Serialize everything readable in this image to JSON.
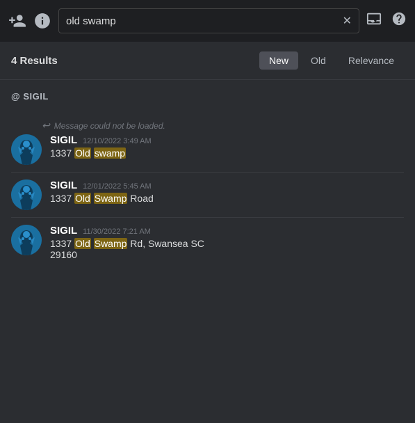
{
  "toolbar": {
    "search_value": "old swamp",
    "search_placeholder": "Search",
    "clear_button_label": "✕"
  },
  "results": {
    "count_label": "4 Results",
    "filters": [
      {
        "id": "new",
        "label": "New",
        "active": true
      },
      {
        "id": "old",
        "label": "Old",
        "active": false
      },
      {
        "id": "relevance",
        "label": "Relevance",
        "active": false
      }
    ]
  },
  "channel": {
    "label": "@ SIGIL"
  },
  "messages": [
    {
      "id": "msg1",
      "has_reply": true,
      "reply_text": "Message could not be loaded.",
      "author": "SIGIL",
      "timestamp": "12/10/2022 3:49 AM",
      "text_parts": [
        {
          "type": "plain",
          "text": "1337 "
        },
        {
          "type": "highlight",
          "text": "Old"
        },
        {
          "type": "plain",
          "text": " "
        },
        {
          "type": "highlight",
          "text": "swamp"
        }
      ]
    },
    {
      "id": "msg2",
      "has_reply": false,
      "author": "SIGIL",
      "timestamp": "12/01/2022 5:45 AM",
      "text_parts": [
        {
          "type": "plain",
          "text": "1337 "
        },
        {
          "type": "highlight",
          "text": "Old"
        },
        {
          "type": "plain",
          "text": " "
        },
        {
          "type": "highlight",
          "text": "Swamp"
        },
        {
          "type": "plain",
          "text": " Road"
        }
      ]
    },
    {
      "id": "msg3",
      "has_reply": false,
      "author": "SIGIL",
      "timestamp": "11/30/2022 7:21 AM",
      "text_parts": [
        {
          "type": "plain",
          "text": "1337 "
        },
        {
          "type": "highlight",
          "text": "Old"
        },
        {
          "type": "plain",
          "text": " "
        },
        {
          "type": "highlight",
          "text": "Swamp"
        },
        {
          "type": "plain",
          "text": " Rd, Swansea SC"
        },
        {
          "type": "newline",
          "text": ""
        },
        {
          "type": "plain",
          "text": "29160"
        }
      ]
    }
  ]
}
